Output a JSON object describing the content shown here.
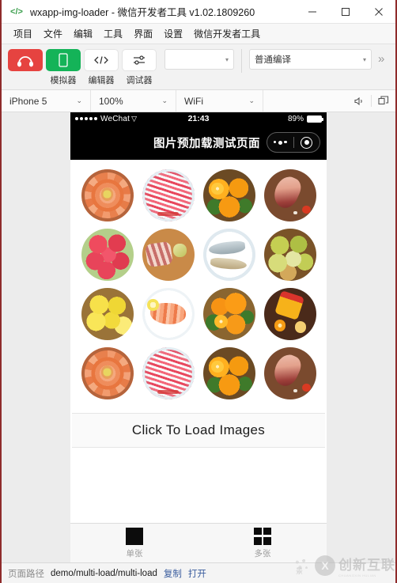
{
  "window": {
    "title": "wxapp-img-loader - 微信开发者工具 v1.02.1809260",
    "logo_icon": "code-brackets-icon",
    "controls": [
      {
        "name": "minimize-button",
        "glyph": "—"
      },
      {
        "name": "maximize-button",
        "glyph": "□"
      },
      {
        "name": "close-button",
        "glyph": "✕"
      }
    ]
  },
  "menubar": {
    "items": [
      "项目",
      "文件",
      "编辑",
      "工具",
      "界面",
      "设置",
      "微信开发者工具"
    ]
  },
  "toolbar": {
    "buttons": [
      {
        "name": "audio-tool-button",
        "icon": "headphone-icon",
        "label": "",
        "color": "#e64340"
      },
      {
        "name": "simulator-button",
        "icon": "phone-icon",
        "label": "模拟器",
        "color": "#14b358"
      },
      {
        "name": "editor-button",
        "icon": "code-icon",
        "label": "编辑器",
        "color": "#ffffff"
      },
      {
        "name": "debugger-button",
        "icon": "sliders-icon",
        "label": "调试器",
        "color": "#ffffff"
      }
    ],
    "blank_select": {
      "value": "",
      "caret": "▾"
    },
    "compile_select": {
      "value": "普通编译",
      "caret": "▾"
    },
    "more_icon": "chevron-double-right-icon",
    "more_glyph": "»"
  },
  "devicebar": {
    "device": {
      "value": "iPhone 5",
      "caret": "⌄"
    },
    "zoom": {
      "value": "100%",
      "caret": "⌄"
    },
    "network": {
      "value": "WiFi",
      "caret": "⌄"
    },
    "icons": [
      {
        "name": "mute-icon",
        "glyph": "◁)"
      },
      {
        "name": "detach-window-icon",
        "glyph": "❐"
      }
    ]
  },
  "simulator": {
    "statusbar": {
      "carrier": "WeChat",
      "wifi_icon": "wifi-icon",
      "time": "21:43",
      "battery_percent": "89%",
      "signal_dots": 5
    },
    "navbar": {
      "title": "图片预加载测试页面",
      "capsule": {
        "menu_icon": "ellipsis-icon",
        "target_icon": "target-circle-icon"
      }
    },
    "grid": {
      "columns": 4,
      "items": [
        {
          "name": "food-image-salmon",
          "alt": "三文鱼刺身拼盘",
          "style": "f-salmon"
        },
        {
          "name": "food-image-bacon",
          "alt": "五花肉卷片",
          "style": "f-bacon"
        },
        {
          "name": "food-image-oranges",
          "alt": "橙子",
          "style": "f-orange"
        },
        {
          "name": "food-image-lamb-leg",
          "alt": "羊腿肉",
          "style": "f-meat"
        },
        {
          "name": "food-image-apples",
          "alt": "红苹果",
          "style": "f-apples"
        },
        {
          "name": "food-image-lamb-chops",
          "alt": "羊排",
          "style": "f-lamb"
        },
        {
          "name": "food-image-fish",
          "alt": "鲜鱼拼盘",
          "style": "f-fish"
        },
        {
          "name": "food-image-pears",
          "alt": "青梨",
          "style": "f-pears"
        },
        {
          "name": "food-image-lemons",
          "alt": "柠檬",
          "style": "f-lemons"
        },
        {
          "name": "food-image-shrimp",
          "alt": "大虾",
          "style": "f-shrimp"
        },
        {
          "name": "food-image-oranges-2",
          "alt": "橙子篮",
          "style": "f-orange2"
        },
        {
          "name": "food-image-juice",
          "alt": "橙汁饮料",
          "style": "f-juice"
        },
        {
          "name": "food-image-salmon-2",
          "alt": "三文鱼刺身拼盘",
          "style": "f-salmon"
        },
        {
          "name": "food-image-bacon-2",
          "alt": "五花肉卷片",
          "style": "f-bacon"
        },
        {
          "name": "food-image-oranges-3",
          "alt": "橙子",
          "style": "f-orange"
        },
        {
          "name": "food-image-lamb-leg-2",
          "alt": "羊腿肉",
          "style": "f-meat"
        }
      ]
    },
    "load_button": {
      "label": "Click To Load Images"
    },
    "tabbar": {
      "tabs": [
        {
          "name": "tab-single",
          "label": "单张",
          "icon": "square-icon"
        },
        {
          "name": "tab-multi",
          "label": "多张",
          "icon": "grid-icon"
        }
      ]
    }
  },
  "statusbar": {
    "path_key": "页面路径",
    "path_value": "demo/multi-load/multi-load",
    "copy_label": "复制",
    "open_label": "打开",
    "watermark": {
      "mark": "X",
      "text": "创新互联",
      "sub": "CHUANGXIN HULIAN"
    }
  }
}
